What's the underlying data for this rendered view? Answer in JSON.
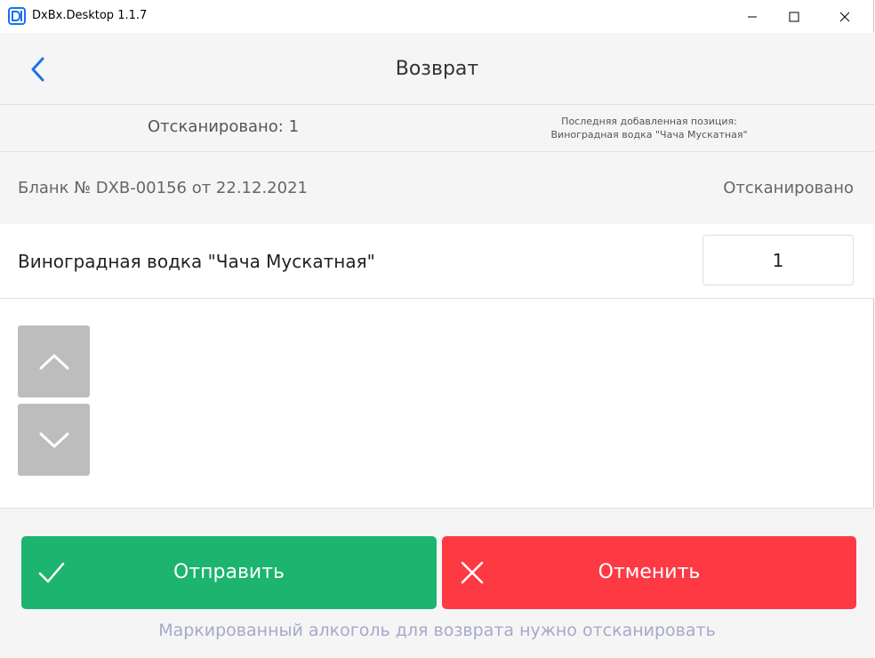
{
  "window": {
    "title": "DxBx.Desktop 1.1.7"
  },
  "header": {
    "title": "Возврат"
  },
  "info": {
    "scanned_count": "Отсканировано: 1",
    "last_added_label": "Последняя добавленная позиция:",
    "last_added_value": "Виноградная водка \"Чача Мускатная\""
  },
  "form": {
    "number": "Бланк № DXB-00156 от 22.12.2021",
    "status": "Отсканировано"
  },
  "items": [
    {
      "name": "Виноградная водка \"Чача Мускатная\"",
      "quantity": "1"
    }
  ],
  "actions": {
    "send_label": "Отправить",
    "cancel_label": "Отменить"
  },
  "footer": {
    "note": "Маркированный алкоголь для возврата нужно отсканировать"
  },
  "colors": {
    "accent_blue": "#1a73e8",
    "send_green": "#1cb46e",
    "cancel_red": "#fd3a44",
    "note_text": "#a7a9c8",
    "scroll_button": "#bdbdbd"
  },
  "icons": {
    "app": "dxbx-logo-icon",
    "back": "chevron-left-icon",
    "scroll_up": "chevron-up-icon",
    "scroll_down": "chevron-down-icon",
    "send": "checkmark-icon",
    "cancel": "close-icon"
  }
}
